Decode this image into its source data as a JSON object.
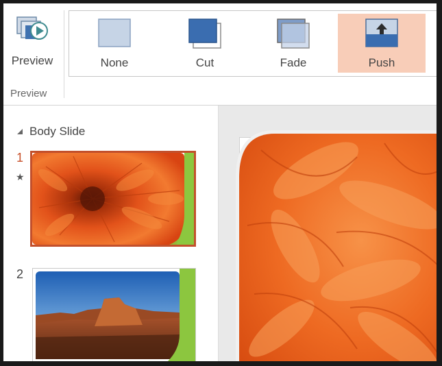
{
  "ribbon": {
    "preview_button": {
      "label": "Preview",
      "icon": "preview-play-icon"
    },
    "preview_group_label": "Preview",
    "transitions": [
      {
        "label": "None",
        "icon": "transition-none-icon",
        "selected": false
      },
      {
        "label": "Cut",
        "icon": "transition-cut-icon",
        "selected": false
      },
      {
        "label": "Fade",
        "icon": "transition-fade-icon",
        "selected": false
      },
      {
        "label": "Push",
        "icon": "transition-push-icon",
        "selected": true
      }
    ]
  },
  "thumbnail_pane": {
    "section_title": "Body Slide",
    "slides": [
      {
        "number": "1",
        "selected": true,
        "has_animation": true,
        "picture": "orange-flower"
      },
      {
        "number": "2",
        "selected": false,
        "has_animation": false,
        "picture": "desert-mesa"
      }
    ]
  },
  "colors": {
    "accent": "#c2502c",
    "selected_transition": "#f8cdb8",
    "slide_accent_green": "#8cc63f"
  }
}
